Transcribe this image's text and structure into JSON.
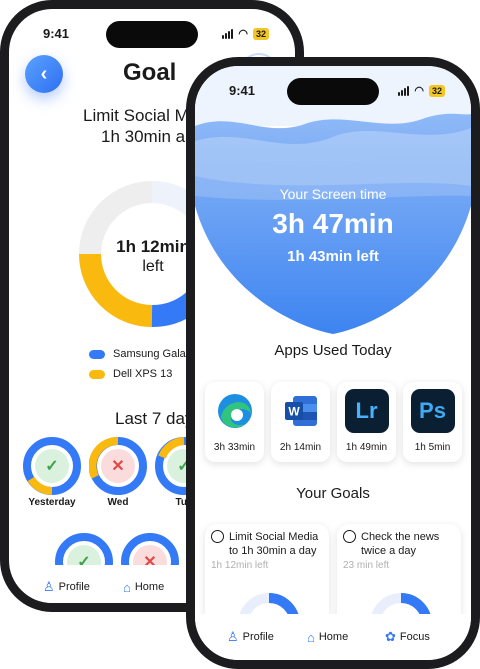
{
  "status": {
    "time_back": "9:41",
    "time_front": "9:41",
    "battery_back": "32",
    "battery_front": "32"
  },
  "goal_screen": {
    "title": "Goal",
    "goal_line1": "Limit Social Media",
    "goal_line2": "1h 30min a day",
    "remaining_value": "1h 12min",
    "remaining_suffix": "left",
    "legend": [
      {
        "label": "Samsung Galaxy",
        "color": "#3479f6"
      },
      {
        "label": "Dell XPS 13",
        "color": "#f9b90f"
      }
    ],
    "last7_title": "Last 7 days",
    "days": [
      {
        "label": "Yesterday",
        "status": "check",
        "mark": "✓"
      },
      {
        "label": "Wed",
        "status": "cross",
        "mark": "✕"
      },
      {
        "label": "Tue",
        "status": "check",
        "mark": "✓"
      },
      {
        "label": "",
        "status": "check",
        "mark": "✓"
      },
      {
        "label": "",
        "status": "cross",
        "mark": "✕"
      }
    ],
    "tabs": [
      {
        "label": "Profile",
        "icon": "person-icon"
      },
      {
        "label": "Home",
        "icon": "home-icon"
      }
    ]
  },
  "home_screen": {
    "screen_time_label": "Your Screen time",
    "screen_time_value": "3h 47min",
    "time_left": "1h 43min left",
    "apps_title": "Apps Used Today",
    "apps": [
      {
        "name": "Microsoft Edge",
        "duration": "3h 33min",
        "icon": "edge-icon"
      },
      {
        "name": "Microsoft Word",
        "duration": "2h 14min",
        "icon": "word-icon",
        "glyph": "W"
      },
      {
        "name": "Adobe Lightroom",
        "duration": "1h 49min",
        "icon": "lightroom-icon",
        "glyph": "Lr"
      },
      {
        "name": "Adobe Photoshop",
        "duration": "1h 5min",
        "icon": "photoshop-icon",
        "glyph": "Ps"
      }
    ],
    "goals_title": "Your Goals",
    "goals": [
      {
        "title": "Limit Social Media to 1h 30min a day",
        "left": "1h 12min left"
      },
      {
        "title": "Check the news twice a day",
        "left": "23 min left"
      }
    ],
    "tabs": [
      {
        "label": "Profile",
        "icon": "person-icon"
      },
      {
        "label": "Home",
        "icon": "home-icon"
      },
      {
        "label": "Focus",
        "icon": "focus-flower-icon"
      }
    ]
  },
  "colors": {
    "accent": "#3479f6",
    "secondary": "#f9b90f",
    "success": "#3fa24c",
    "danger": "#e24848"
  }
}
